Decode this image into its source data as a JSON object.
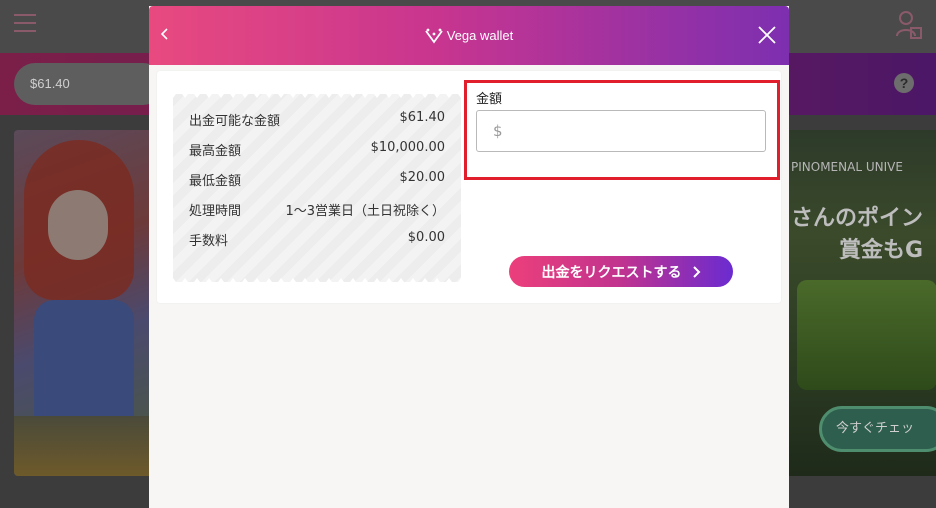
{
  "background": {
    "balance": "$61.40",
    "help_icon": "?",
    "banner_right_line1": "PINOMENAL UNIVE",
    "banner_right_line2": "さんのポイン",
    "banner_right_line3": "賞金もG",
    "banner_right_cta": "今すぐチェッ"
  },
  "modal": {
    "back_icon": "chevron-left-icon",
    "brand_name": "Vega wallet",
    "close_icon": "close-icon",
    "info": [
      {
        "label": "出金可能な金額",
        "value": "$61.40"
      },
      {
        "label": "最高金額",
        "value": "$10,000.00"
      },
      {
        "label": "最低金額",
        "value": "$20.00"
      },
      {
        "label": "処理時間",
        "value": "1〜3営業日（土日祝除く）"
      },
      {
        "label": "手数料",
        "value": "$0.00"
      }
    ],
    "amount": {
      "label": "金額",
      "placeholder": "$",
      "value": ""
    },
    "request_button": "出金をリクエストする",
    "highlight_color": "#e01e2c",
    "accent_gradient": [
      "#e84a7f",
      "#7d2fb0"
    ]
  }
}
